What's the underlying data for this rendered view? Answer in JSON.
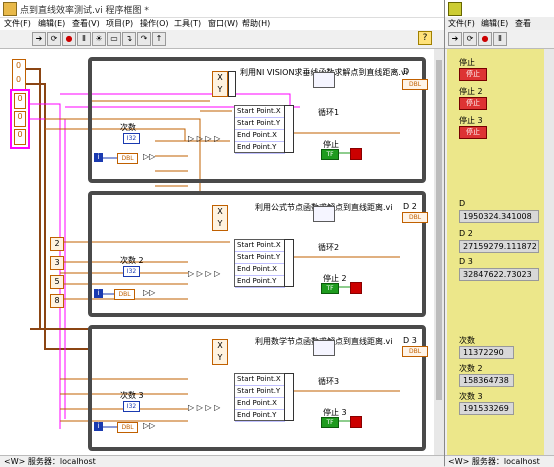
{
  "block_window": {
    "title": "点到直线效率测试.vi 程序框图 *",
    "menu": [
      "文件(F)",
      "编辑(E)",
      "查看(V)",
      "项目(P)",
      "操作(O)",
      "工具(T)",
      "窗口(W)",
      "帮助(H)"
    ],
    "help_glyph": "?",
    "status_server": "<W> 服务器：localhost",
    "loops": [
      {
        "subvi_caption": "利用NI VISION求垂线函数求解点到直线距离.vi",
        "indicator": "D",
        "loop_label": "循环1",
        "stop_label": "停止",
        "count_label": "次数",
        "inputs": [
          "Start Point.X",
          "Start Point.Y",
          "End Point.X",
          "End Point.Y"
        ]
      },
      {
        "subvi_caption": "利用公式节点函数求解点到直线距离.vi",
        "indicator": "D 2",
        "loop_label": "循环2",
        "stop_label": "停止 2",
        "count_label": "次数 2",
        "inputs": [
          "Start Point.X",
          "Start Point.Y",
          "End Point.X",
          "End Point.Y"
        ]
      },
      {
        "subvi_caption": "利用数学节点函数求解点到直线距离.vi",
        "indicator": "D 3",
        "loop_label": "循环3",
        "stop_label": "停止 3",
        "count_label": "次数 3",
        "inputs": [
          "Start Point.X",
          "Start Point.Y",
          "End Point.X",
          "End Point.Y"
        ]
      }
    ],
    "xy_labels": [
      "X",
      "Y"
    ],
    "i32_label": "I32",
    "dbl_label": "DBL",
    "tf_label": "TF",
    "consts_top": [
      "0",
      "0"
    ],
    "consts_pink": [
      "0",
      "0",
      "0"
    ],
    "consts_mid": [
      "2",
      "3",
      "5",
      "8"
    ]
  },
  "front_window": {
    "menu": [
      "文件(F)",
      "编辑(E)",
      "查看"
    ],
    "stops": [
      {
        "label": "停止",
        "button": "停止"
      },
      {
        "label": "停止 2",
        "button": "停止"
      },
      {
        "label": "停止 3",
        "button": "停止"
      }
    ],
    "distances": [
      {
        "label": "D",
        "value": "1950324.341008"
      },
      {
        "label": "D 2",
        "value": "27159279.111872"
      },
      {
        "label": "D 3",
        "value": "32847622.73023"
      }
    ],
    "counts": [
      {
        "label": "次数",
        "value": "11372290"
      },
      {
        "label": "次数 2",
        "value": "158364738"
      },
      {
        "label": "次数 3",
        "value": "191533269"
      }
    ],
    "status_server": "<W> 服务器：localhost"
  },
  "colors": {
    "wire_orange": "#c06000",
    "wire_pink": "#ff00ff",
    "wire_brown": "#8b4513",
    "wire_blue": "#1a3ab0",
    "wire_green": "#1e9b1e",
    "panel_bg": "#ece78a",
    "stop_red": "#dd3333"
  }
}
